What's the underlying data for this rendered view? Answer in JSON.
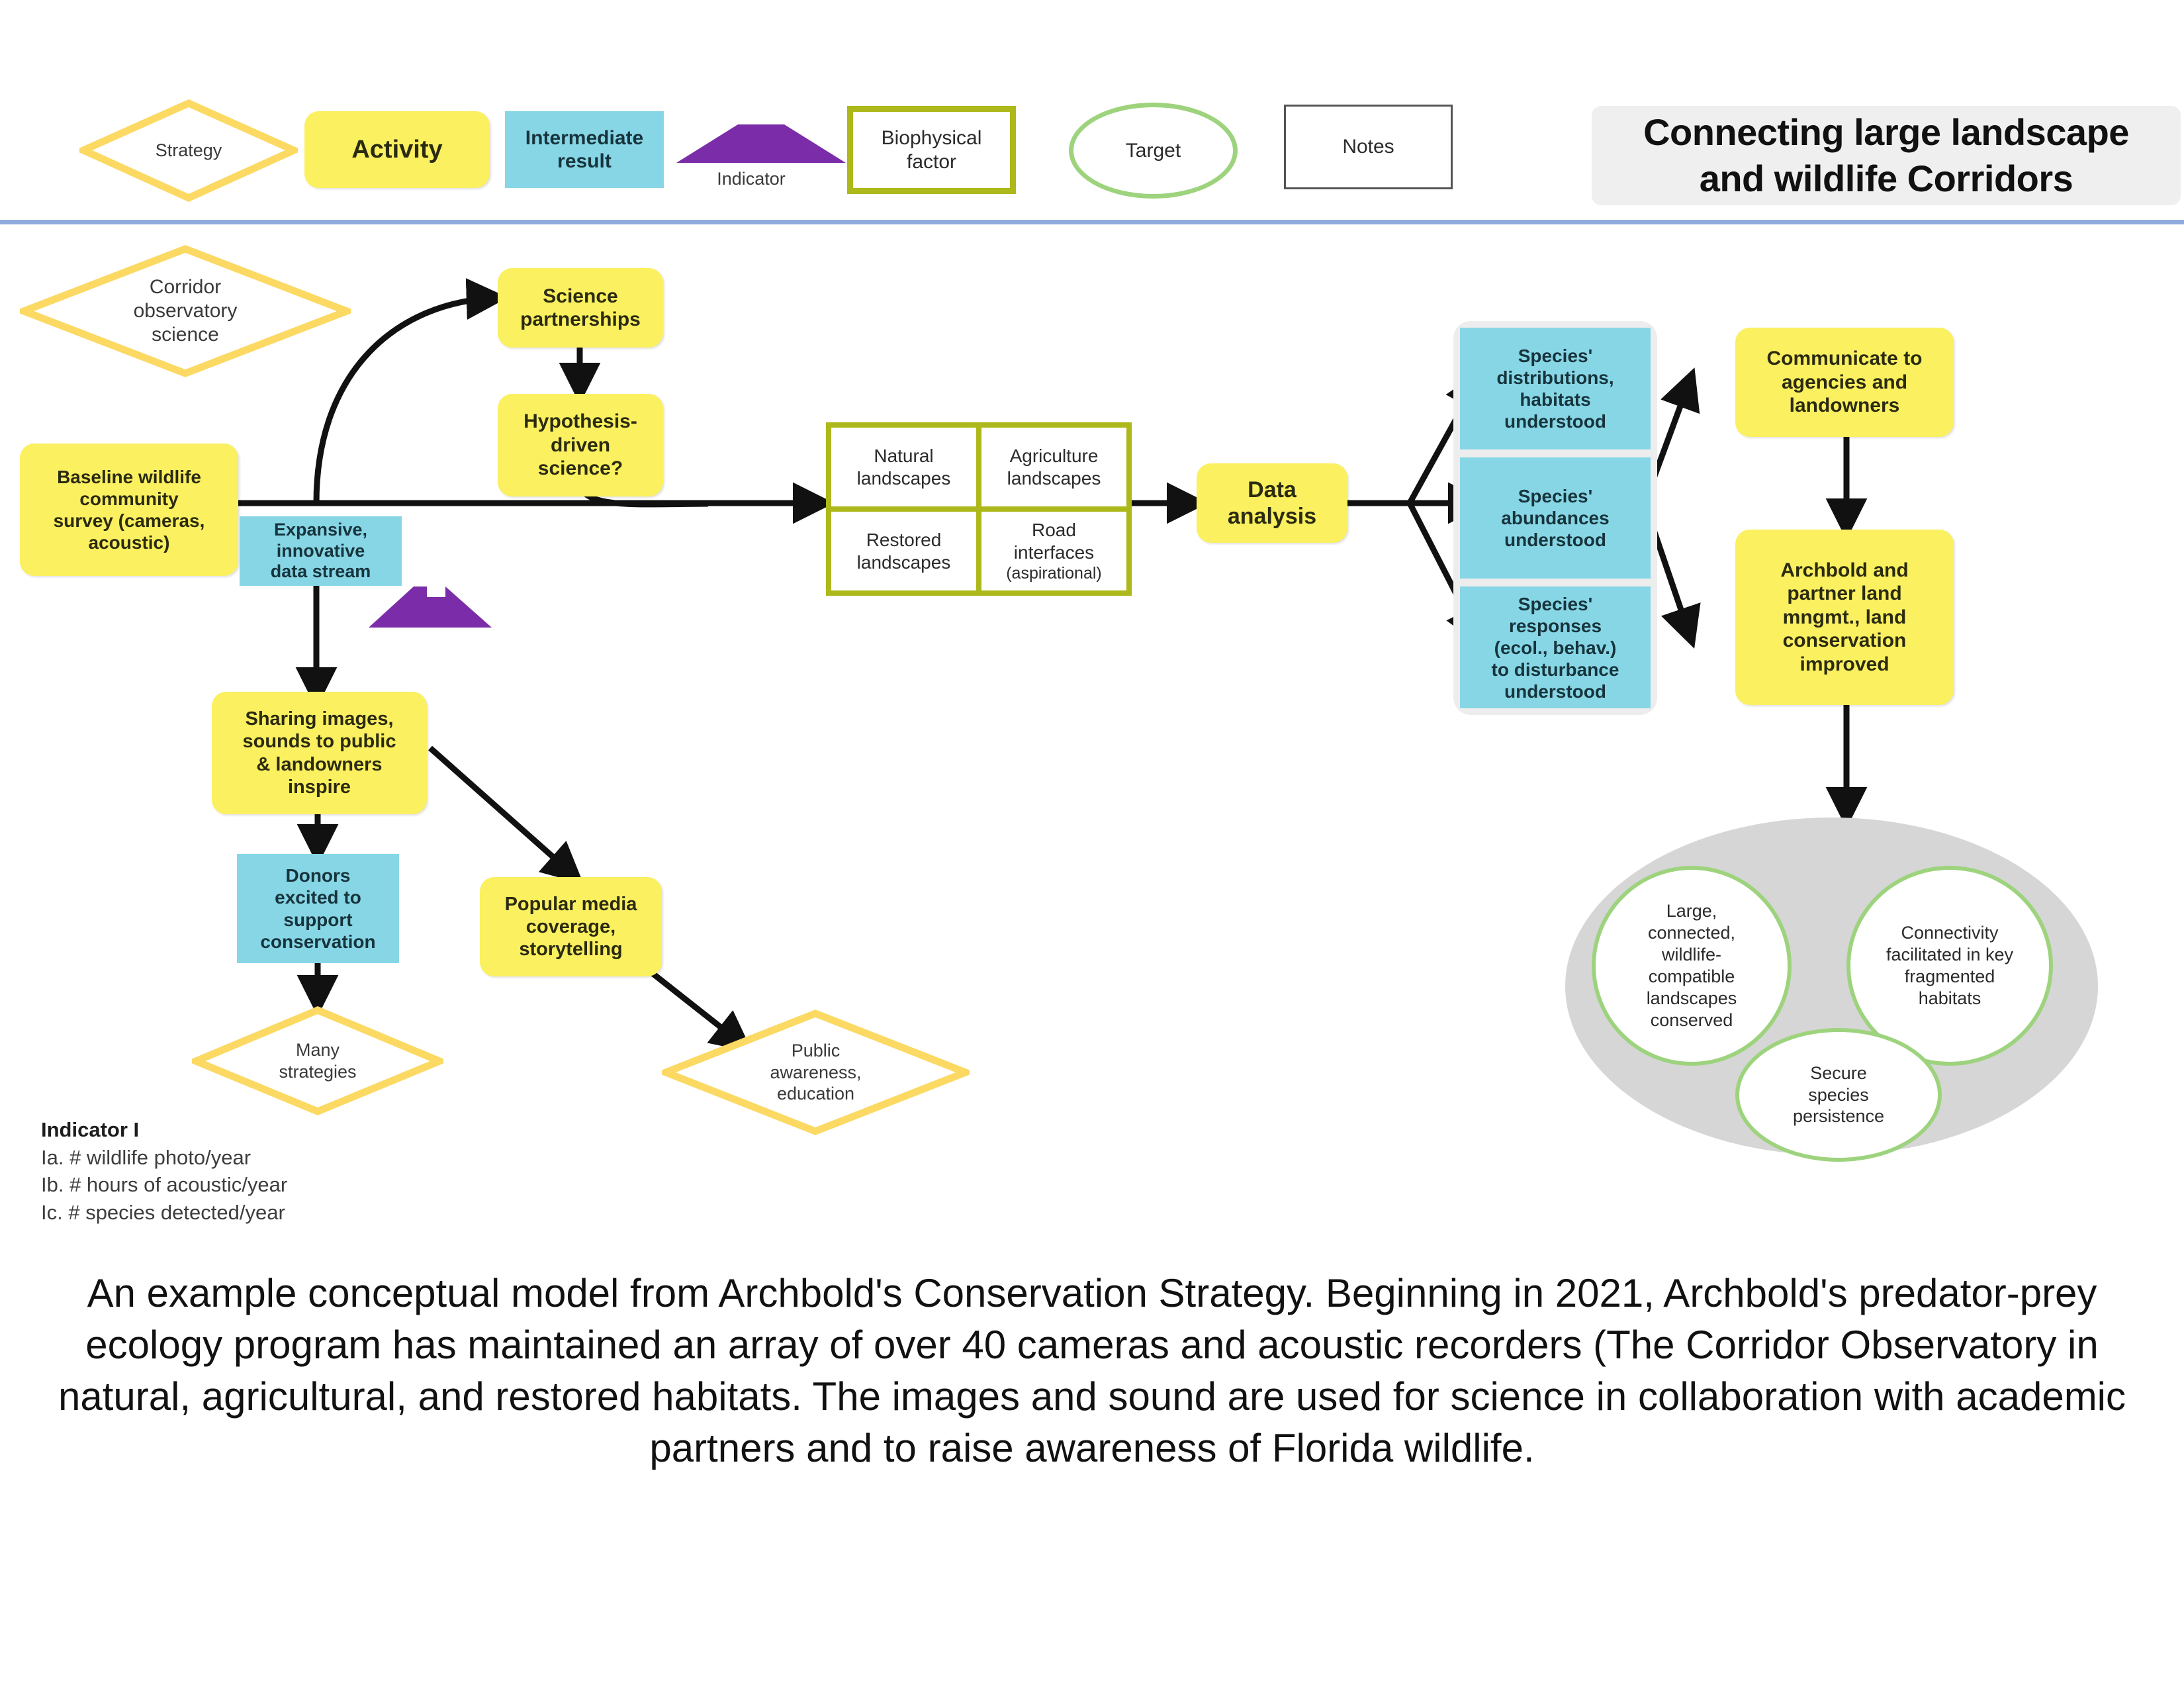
{
  "header": {
    "banner_line1": "Connecting large landscape",
    "banner_line2": "and wildlife Corridors"
  },
  "legend": {
    "strategy": "Strategy",
    "activity": "Activity",
    "intermediate_result": "Intermediate\nresult",
    "intermediate_result_l1": "Intermediate",
    "intermediate_result_l2": "result",
    "indicator": "Indicator",
    "biophysical_l1": "Biophysical",
    "biophysical_l2": "factor",
    "target": "Target",
    "notes": "Notes"
  },
  "colors": {
    "activity_yellow": "#FBF05F",
    "strategy_outline": "#FBD963",
    "intermediate_blue": "#87D6E6",
    "indicator_purple": "#7B2CA8",
    "biophysical_olive": "#ADB81A",
    "target_green": "#9ED37E",
    "group_gray": "#EDEDED",
    "oval_gray": "#D6D6D6",
    "rule_blue": "#8FAADC",
    "banner_gray": "#EFEFEF"
  },
  "diagram": {
    "strategy_corridor": "Corridor\nobservatory\nscience",
    "strategy_corridor_lines": [
      "Corridor",
      "observatory",
      "science"
    ],
    "baseline_survey": "Baseline wildlife community survey (cameras, acoustic)",
    "baseline_survey_lines": [
      "Baseline wildlife",
      "community",
      "survey (cameras,",
      "acoustic)"
    ],
    "science_partnerships_lines": [
      "Science",
      "partnerships"
    ],
    "hypothesis_lines": [
      "Hypothesis-",
      "driven",
      "science?"
    ],
    "expansive_lines": [
      "Expansive,",
      "innovative",
      "data stream"
    ],
    "quad": {
      "natural_l1": "Natural",
      "natural_l2": "landscapes",
      "agriculture_l1": "Agriculture",
      "agriculture_l2": "landscapes",
      "restored_l1": "Restored",
      "restored_l2": "landscapes",
      "road_l1": "Road",
      "road_l2": "interfaces",
      "road_l3": "(aspirational)"
    },
    "data_analysis_lines": [
      "Data",
      "analysis"
    ],
    "species": [
      {
        "lines": [
          "Species'",
          "distributions,",
          "habitats",
          "understood"
        ]
      },
      {
        "lines": [
          "Species'",
          "abundances",
          "understood"
        ]
      },
      {
        "lines": [
          "Species'",
          "responses",
          "(ecol., behav.)",
          "to disturbance",
          "understood"
        ]
      }
    ],
    "communicate_lines": [
      "Communicate to",
      "agencies and",
      "landowners"
    ],
    "archbold_lines": [
      "Archbold and",
      "partner land",
      "mngmt., land",
      "conservation",
      "improved"
    ],
    "sharing_lines": [
      "Sharing images,",
      "sounds to public",
      "& landowners",
      "inspire"
    ],
    "donors_lines": [
      "Donors",
      "excited to",
      "support",
      "conservation"
    ],
    "many_strategies_lines": [
      "Many",
      "strategies"
    ],
    "popular_media_lines": [
      "Popular media",
      "coverage,",
      "storytelling"
    ],
    "public_awareness_lines": [
      "Public",
      "awareness,",
      "education"
    ],
    "targets": [
      {
        "lines": [
          "Large,",
          "connected,",
          "wildlife-",
          "compatible",
          "landscapes",
          "conserved"
        ]
      },
      {
        "lines": [
          "Connectivity",
          "facilitated in key",
          "fragmented",
          "habitats"
        ]
      },
      {
        "lines": [
          "Secure",
          "species",
          "persistence"
        ]
      }
    ]
  },
  "indicator_list": {
    "title": "Indicator I",
    "items": [
      "Ia. # wildlife photo/year",
      "Ib. # hours of acoustic/year",
      "Ic. # species detected/year"
    ]
  },
  "caption": {
    "text": "An example conceptual model from Archbold's Conservation Strategy. Beginning in 2021, Archbold's predator-prey ecology program has maintained an array of over 40 cameras and acoustic recorders (The Corridor Observatory in natural, agricultural, and restored habitats. The images and sound are used for science in collaboration with academic partners and to raise awareness of Florida wildlife."
  }
}
